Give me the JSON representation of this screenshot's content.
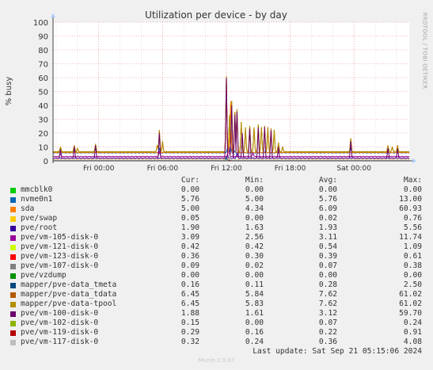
{
  "chart_data": {
    "type": "line",
    "title": "Utilization per device - by day",
    "ylabel": "% busy",
    "ylim": [
      0,
      100
    ],
    "y_ticks": [
      "0",
      "10",
      "20",
      "30",
      "40",
      "50",
      "60",
      "70",
      "80",
      "90",
      "100"
    ],
    "x_tick_labels": [
      "Fri 00:00",
      "Fri 06:00",
      "Fri 12:00",
      "Fri 18:00",
      "Sat 00:00"
    ],
    "x_tick_hours": [
      0,
      6,
      12,
      18,
      24
    ],
    "x_range_hours": [
      -4.3,
      29.2
    ],
    "grid": true,
    "series_colors": [
      "#00cc00",
      "#0066b3",
      "#ff8000",
      "#ffcc00",
      "#330099",
      "#990099",
      "#ccff00",
      "#ff0000",
      "#808080",
      "#008f00",
      "#00487d",
      "#b35a00",
      "#b38f00",
      "#6b006b",
      "#8fb300",
      "#b30000",
      "#bebebe"
    ],
    "series": [
      {
        "name": "mmcblk0",
        "base": 0.0,
        "points": []
      },
      {
        "name": "nvme0n1",
        "base": 5.8,
        "points": [
          [
            -3.6,
            6.5
          ],
          [
            -2.3,
            8
          ],
          [
            -0.3,
            9
          ],
          [
            5.7,
            9
          ],
          [
            12.1,
            9
          ],
          [
            12.4,
            10
          ],
          [
            12.8,
            7
          ],
          [
            13.5,
            6
          ],
          [
            15.7,
            7
          ],
          [
            23.7,
            9
          ]
        ]
      },
      {
        "name": "sda",
        "base": 6.0,
        "points": [
          [
            12.0,
            60.9
          ],
          [
            12.4,
            43
          ],
          [
            12.8,
            35
          ]
        ]
      },
      {
        "name": "pve/swap",
        "base": 0.1,
        "points": []
      },
      {
        "name": "pve/root",
        "base": 1.9,
        "points": [
          [
            12.1,
            4
          ],
          [
            13.0,
            5.6
          ]
        ]
      },
      {
        "name": "pve/vm-105-disk-0",
        "base": 3.1,
        "points": [
          [
            -3.6,
            5
          ],
          [
            5.7,
            7
          ],
          [
            12.2,
            11.7
          ],
          [
            14.5,
            6
          ]
        ]
      },
      {
        "name": "pve/vm-121-disk-0",
        "base": 0.5,
        "points": []
      },
      {
        "name": "pve/vm-123-disk-0",
        "base": 0.4,
        "points": []
      },
      {
        "name": "pve/vm-107-disk-0",
        "base": 0.1,
        "points": []
      },
      {
        "name": "pve/vzdump",
        "base": 0.0,
        "points": []
      },
      {
        "name": "mapper/pve-data_tmeta",
        "base": 0.2,
        "points": [
          [
            12.0,
            2.5
          ]
        ]
      },
      {
        "name": "mapper/pve-data_tdata",
        "base": 6.5,
        "points": [
          [
            -3.6,
            10
          ],
          [
            -2.3,
            11
          ],
          [
            -2.0,
            9
          ],
          [
            -0.3,
            12
          ],
          [
            5.5,
            11
          ],
          [
            5.7,
            22
          ],
          [
            6.0,
            14
          ],
          [
            12.0,
            61
          ],
          [
            12.3,
            33
          ],
          [
            12.5,
            43
          ],
          [
            12.8,
            35
          ],
          [
            13.0,
            37
          ],
          [
            13.4,
            28
          ],
          [
            13.8,
            24
          ],
          [
            14.2,
            25
          ],
          [
            14.6,
            24
          ],
          [
            15.0,
            26
          ],
          [
            15.3,
            24
          ],
          [
            15.6,
            25
          ],
          [
            15.9,
            24
          ],
          [
            16.2,
            23
          ],
          [
            16.5,
            22
          ],
          [
            16.9,
            13
          ],
          [
            17.3,
            10
          ],
          [
            23.7,
            16
          ],
          [
            27.2,
            11
          ],
          [
            27.6,
            10
          ],
          [
            28.1,
            11
          ]
        ]
      },
      {
        "name": "mapper/pve-data-tpool",
        "base": 6.5,
        "points": [
          [
            -3.6,
            10
          ],
          [
            -2.3,
            11
          ],
          [
            -2.0,
            9
          ],
          [
            -0.3,
            12
          ],
          [
            5.5,
            11
          ],
          [
            5.7,
            22
          ],
          [
            6.0,
            14
          ],
          [
            12.0,
            61
          ],
          [
            12.3,
            33
          ],
          [
            12.5,
            43
          ],
          [
            12.8,
            35
          ],
          [
            13.0,
            37
          ],
          [
            13.4,
            28
          ],
          [
            13.8,
            24
          ],
          [
            14.2,
            25
          ],
          [
            14.6,
            24
          ],
          [
            15.0,
            26
          ],
          [
            15.3,
            24
          ],
          [
            15.6,
            25
          ],
          [
            15.9,
            24
          ],
          [
            16.2,
            23
          ],
          [
            16.5,
            22
          ],
          [
            16.9,
            13
          ],
          [
            17.3,
            10
          ],
          [
            23.7,
            16
          ],
          [
            27.2,
            11
          ],
          [
            27.6,
            10
          ],
          [
            28.1,
            11
          ]
        ]
      },
      {
        "name": "pve/vm-100-disk-0",
        "base": 1.9,
        "points": [
          [
            -3.6,
            8
          ],
          [
            -2.3,
            10
          ],
          [
            -0.3,
            11
          ],
          [
            5.7,
            20
          ],
          [
            12.0,
            59.7
          ],
          [
            12.5,
            40
          ],
          [
            12.8,
            33
          ],
          [
            13.0,
            35
          ],
          [
            13.5,
            20
          ],
          [
            14.2,
            23
          ],
          [
            15.0,
            24
          ],
          [
            15.6,
            24
          ],
          [
            16.2,
            22
          ],
          [
            16.9,
            10
          ],
          [
            23.7,
            14
          ],
          [
            27.2,
            9
          ],
          [
            28.1,
            9
          ]
        ]
      },
      {
        "name": "pve/vm-102-disk-0",
        "base": 0.1,
        "points": []
      },
      {
        "name": "pve/vm-119-disk-0",
        "base": 0.2,
        "points": [
          [
            12.2,
            0.9
          ]
        ]
      },
      {
        "name": "pve/vm-117-disk-0",
        "base": 0.4,
        "points": [
          [
            12.3,
            4.1
          ]
        ]
      }
    ]
  },
  "legend": {
    "headers": {
      "cur": "Cur:",
      "min": "Min:",
      "avg": "Avg:",
      "max": "Max:"
    },
    "rows": [
      {
        "name": "mmcblk0",
        "color": "#00cc00",
        "cur": "0.00",
        "min": "0.00",
        "avg": "0.00",
        "max": "0.00"
      },
      {
        "name": "nvme0n1",
        "color": "#0066b3",
        "cur": "5.76",
        "min": "5.00",
        "avg": "5.76",
        "max": "13.00"
      },
      {
        "name": "sda",
        "color": "#ff8000",
        "cur": "5.00",
        "min": "4.34",
        "avg": "6.09",
        "max": "60.93"
      },
      {
        "name": "pve/swap",
        "color": "#ffcc00",
        "cur": "0.05",
        "min": "0.00",
        "avg": "0.02",
        "max": "0.76"
      },
      {
        "name": "pve/root",
        "color": "#330099",
        "cur": "1.90",
        "min": "1.63",
        "avg": "1.93",
        "max": "5.56"
      },
      {
        "name": "pve/vm-105-disk-0",
        "color": "#990099",
        "cur": "3.09",
        "min": "2.56",
        "avg": "3.11",
        "max": "11.74"
      },
      {
        "name": "pve/vm-121-disk-0",
        "color": "#ccff00",
        "cur": "0.42",
        "min": "0.42",
        "avg": "0.54",
        "max": "1.09"
      },
      {
        "name": "pve/vm-123-disk-0",
        "color": "#ff0000",
        "cur": "0.36",
        "min": "0.30",
        "avg": "0.39",
        "max": "0.61"
      },
      {
        "name": "pve/vm-107-disk-0",
        "color": "#808080",
        "cur": "0.09",
        "min": "0.02",
        "avg": "0.07",
        "max": "0.38"
      },
      {
        "name": "pve/vzdump",
        "color": "#008f00",
        "cur": "0.00",
        "min": "0.00",
        "avg": "0.00",
        "max": "0.00"
      },
      {
        "name": "mapper/pve-data_tmeta",
        "color": "#00487d",
        "cur": "0.16",
        "min": "0.11",
        "avg": "0.28",
        "max": "2.50"
      },
      {
        "name": "mapper/pve-data_tdata",
        "color": "#b35a00",
        "cur": "6.45",
        "min": "5.84",
        "avg": "7.62",
        "max": "61.02"
      },
      {
        "name": "mapper/pve-data-tpool",
        "color": "#b38f00",
        "cur": "6.45",
        "min": "5.83",
        "avg": "7.62",
        "max": "61.02"
      },
      {
        "name": "pve/vm-100-disk-0",
        "color": "#6b006b",
        "cur": "1.88",
        "min": "1.61",
        "avg": "3.12",
        "max": "59.70"
      },
      {
        "name": "pve/vm-102-disk-0",
        "color": "#8fb300",
        "cur": "0.15",
        "min": "0.00",
        "avg": "0.07",
        "max": "0.24"
      },
      {
        "name": "pve/vm-119-disk-0",
        "color": "#b30000",
        "cur": "0.29",
        "min": "0.16",
        "avg": "0.22",
        "max": "0.91"
      },
      {
        "name": "pve/vm-117-disk-0",
        "color": "#bebebe",
        "cur": "0.32",
        "min": "0.24",
        "avg": "0.36",
        "max": "4.08"
      }
    ]
  },
  "footer": {
    "last_update": "Last update: Sat Sep 21 05:15:06 2024",
    "munin": "Munin 2.0.67",
    "rrdtool": "RRDTOOL / TOBI OETIKER"
  }
}
